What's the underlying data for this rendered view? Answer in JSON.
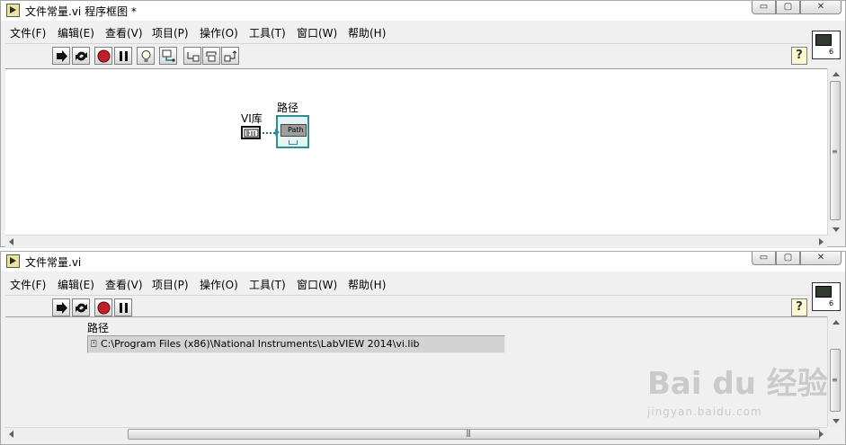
{
  "block_diagram_window": {
    "title": "文件常量.vi 程序框图 *",
    "menu": [
      "文件(F)",
      "编辑(E)",
      "查看(V)",
      "项目(P)",
      "操作(O)",
      "工具(T)",
      "窗口(W)",
      "帮助(H)"
    ],
    "help_button": "?",
    "vi_icon_number": "6",
    "diagram": {
      "constant_label": "VI库",
      "indicator_label": "路径",
      "indicator_text": "Path"
    }
  },
  "front_panel_window": {
    "title": "文件常量.vi",
    "menu": [
      "文件(F)",
      "编辑(E)",
      "查看(V)",
      "项目(P)",
      "操作(O)",
      "工具(T)",
      "窗口(W)",
      "帮助(H)"
    ],
    "help_button": "?",
    "vi_icon_number": "6",
    "path_indicator": {
      "label": "路径",
      "value": "C:\\Program Files (x86)\\National Instruments\\LabVIEW 2014\\vi.lib"
    }
  },
  "window_controls": {
    "minimize": "▭",
    "maximize": "▢",
    "close": "✕"
  },
  "watermark": {
    "main": "Bai du 经验",
    "sub": "jingyan.baidu.com"
  },
  "colors": {
    "wire_path": "#1a7f7f",
    "indicator_border": "#2f8f8f",
    "run_red": "#c0202a"
  }
}
